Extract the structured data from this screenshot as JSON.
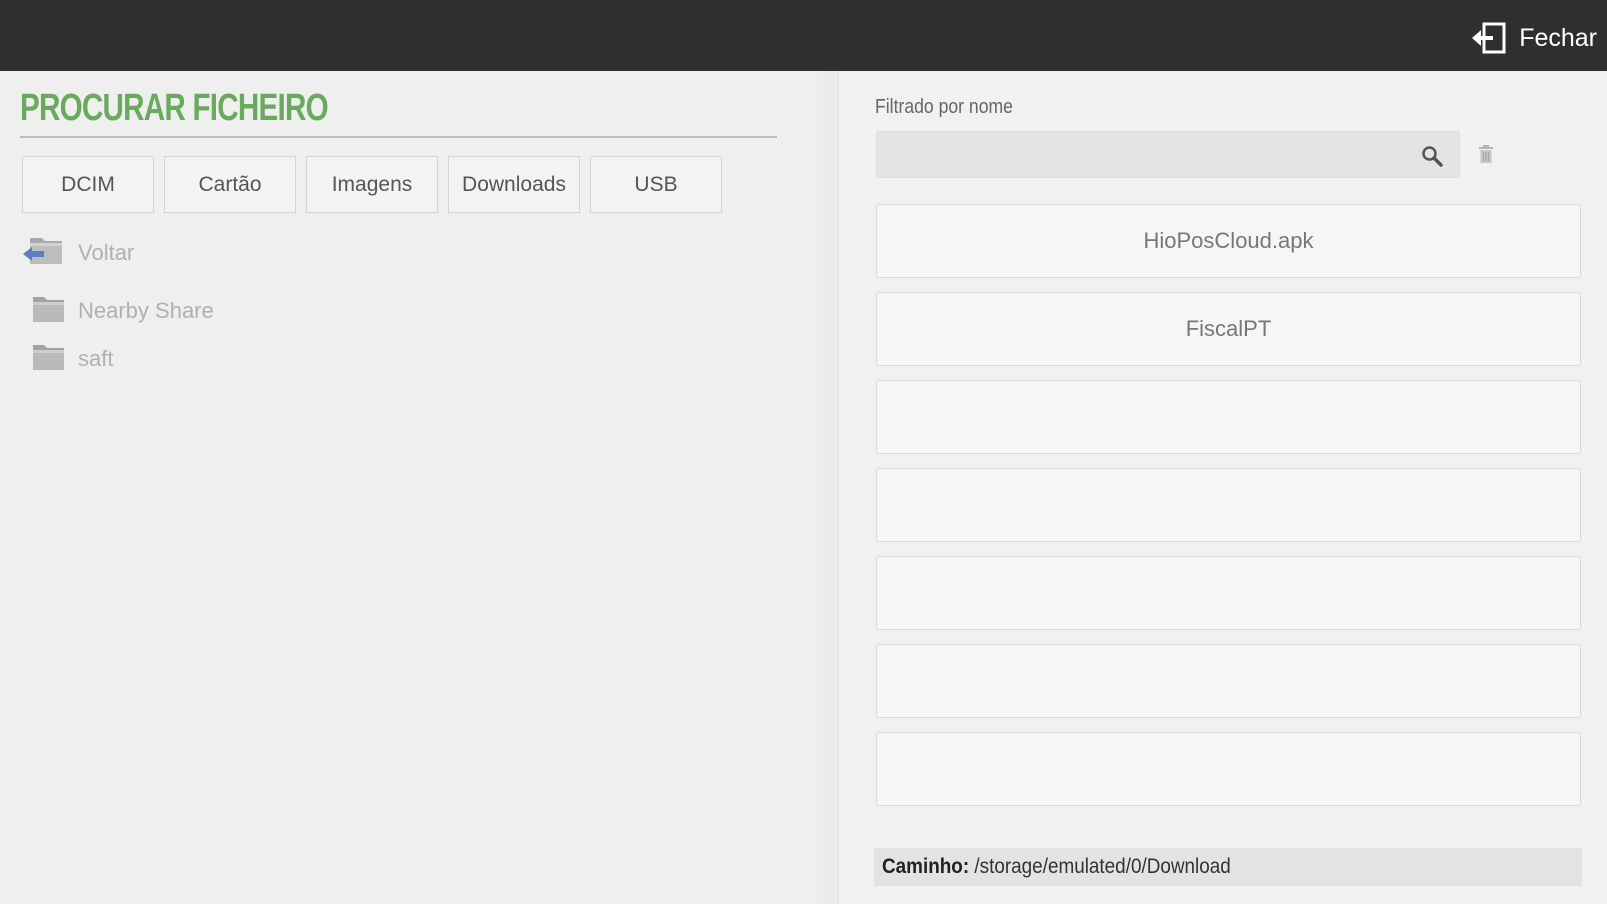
{
  "header": {
    "close_label": "Fechar",
    "close_icon": "exit-door-icon"
  },
  "left": {
    "title": "PROCURAR FICHEIRO",
    "locations": [
      "DCIM",
      "Cartão",
      "Imagens",
      "Downloads",
      "USB"
    ],
    "back_label": "Voltar",
    "back_icon": "folder-back-icon",
    "folders": [
      {
        "name": "Nearby Share",
        "icon": "folder-icon"
      },
      {
        "name": "saft",
        "icon": "folder-icon"
      }
    ]
  },
  "right": {
    "filter_label": "Filtrado por nome",
    "search_value": "",
    "search_icon": "search-icon",
    "clear_icon": "trash-icon",
    "files": [
      "HioPosCloud.apk",
      "FiscalPT",
      "",
      "",
      "",
      "",
      ""
    ],
    "path_label": "Caminho:",
    "path_value": "/storage/emulated/0/Download"
  },
  "colors": {
    "title_green": "#6aaa5e",
    "topbar": "#2f2f2f",
    "back_arrow_blue": "#5b7fc0"
  }
}
